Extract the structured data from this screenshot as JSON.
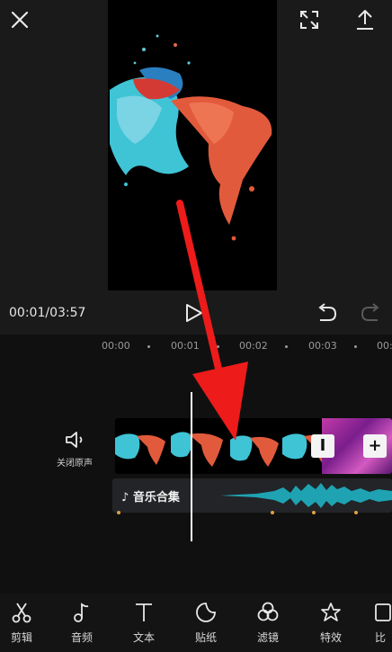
{
  "preview": {
    "time_current": "00:01",
    "time_total": "03:57",
    "time_separator": "/"
  },
  "ruler": {
    "ticks": [
      "00:00",
      "00:01",
      "00:02",
      "00:03",
      "00:0"
    ]
  },
  "timeline": {
    "mute_label": "关闭原声",
    "trim_marker_label": "I",
    "add_clip_label": "+",
    "audio_label": "音乐合集"
  },
  "toolbar": {
    "items": [
      {
        "label": "剪辑",
        "icon": "scissors-icon"
      },
      {
        "label": "音频",
        "icon": "music-note-icon"
      },
      {
        "label": "文本",
        "icon": "text-icon"
      },
      {
        "label": "贴纸",
        "icon": "sticker-icon"
      },
      {
        "label": "滤镜",
        "icon": "filter-icon"
      },
      {
        "label": "特效",
        "icon": "effects-star-icon"
      },
      {
        "label": "比",
        "icon": "ratio-icon"
      }
    ]
  },
  "colors": {
    "background": "#101010",
    "preview_bg": "#1a1a1a",
    "audio_wave": "#1fa3b3",
    "annotation": "#ee1b1b",
    "clip_purple": "#c23aa8"
  }
}
